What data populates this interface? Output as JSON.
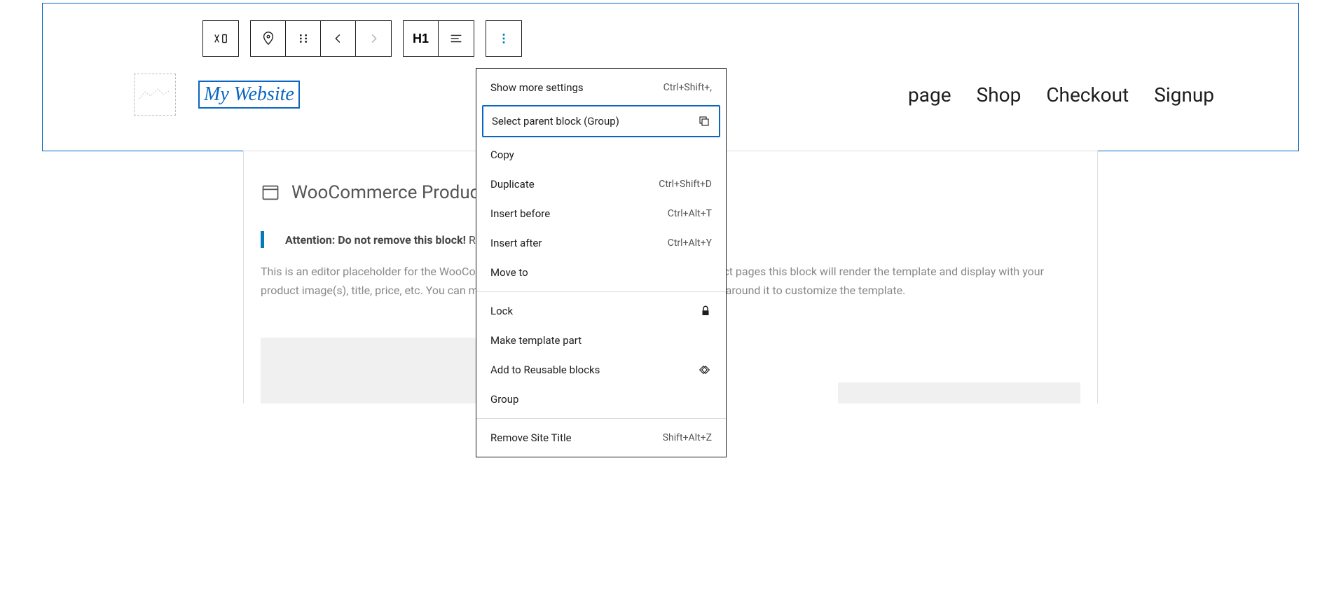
{
  "toolbar": {
    "h1_label": "H1"
  },
  "header": {
    "site_title": "My Website",
    "nav": [
      "page",
      "Shop",
      "Checkout",
      "Signup"
    ]
  },
  "block": {
    "title": "WooCommerce Product Grid",
    "notice_bold": "Attention: Do not remove this block!",
    "notice_rest": "Removal will",
    "description": "This is an editor placeholder for the WooCommerce Product Grid Block. On your store's product pages this block will render the template and display with your product image(s), title, price, etc. You can move this placeholder around and add more blocks around it to customize the template.",
    "description_part1": "This is an editor placeholder for the WooCommerce Produ",
    "description_part2": "the template and display with your product image(s), title, price, etc. You can move this placeholder aro",
    "description_part3": "e template."
  },
  "menu": {
    "items": [
      {
        "label": "Show more settings",
        "shortcut": "Ctrl+Shift+,"
      },
      {
        "label": "Select parent block (Group)",
        "icon": "group"
      },
      {
        "label": "Copy"
      },
      {
        "label": "Duplicate",
        "shortcut": "Ctrl+Shift+D"
      },
      {
        "label": "Insert before",
        "shortcut": "Ctrl+Alt+T"
      },
      {
        "label": "Insert after",
        "shortcut": "Ctrl+Alt+Y"
      },
      {
        "label": "Move to"
      },
      {
        "label": "Lock",
        "icon": "lock"
      },
      {
        "label": "Make template part"
      },
      {
        "label": "Add to Reusable blocks",
        "icon": "reusable"
      },
      {
        "label": "Group"
      },
      {
        "label": "Remove Site Title",
        "shortcut": "Shift+Alt+Z"
      }
    ]
  }
}
